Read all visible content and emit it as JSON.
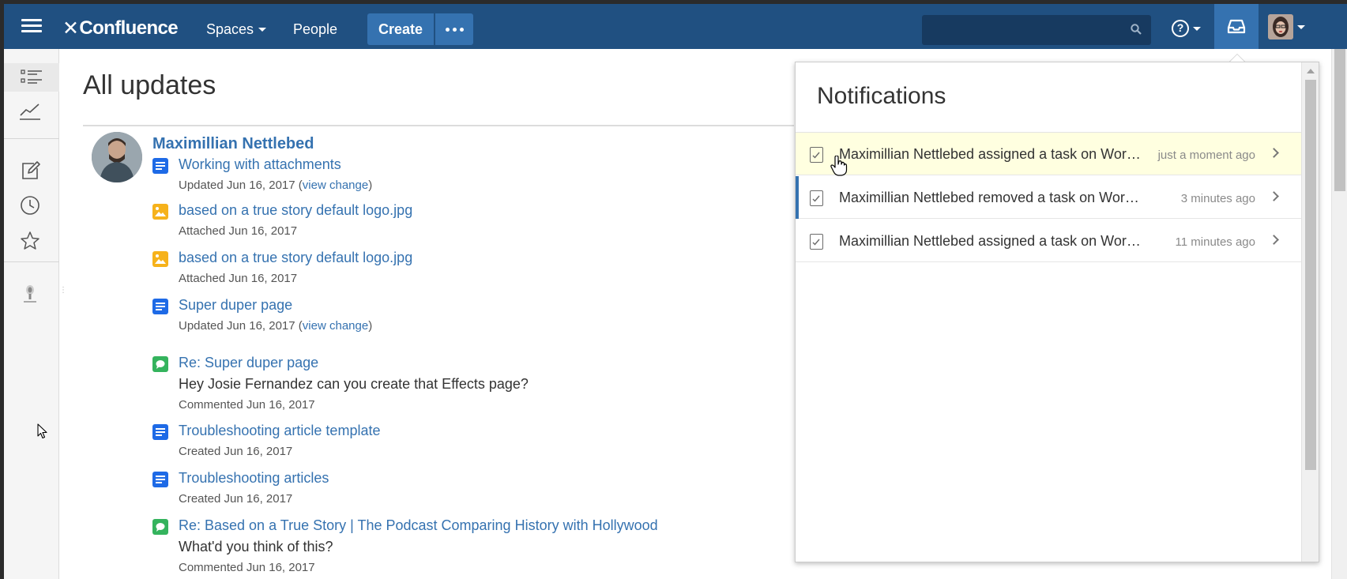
{
  "header": {
    "app_name": "Confluence",
    "logo_mark": "✕",
    "nav": {
      "spaces_label": "Spaces",
      "people_label": "People"
    },
    "create_label": "Create",
    "more_icon": "ellipsis-icon",
    "search": {
      "placeholder": "",
      "value": "",
      "icon": "search-icon"
    },
    "help_icon": "help-icon",
    "help_glyph": "?",
    "notifications_icon": "inbox-icon",
    "avatar_icon": "user-avatar"
  },
  "sidebar": {
    "items": [
      {
        "name": "all-updates",
        "icon": "list-icon",
        "active": true
      },
      {
        "name": "popular",
        "icon": "trending-icon",
        "active": false
      },
      {
        "name": "drafts",
        "icon": "edit-icon",
        "active": false
      },
      {
        "name": "recently-worked",
        "icon": "clock-icon",
        "active": false
      },
      {
        "name": "saved",
        "icon": "star-icon",
        "active": false
      },
      {
        "name": "space",
        "icon": "space-logo-icon",
        "active": false
      }
    ]
  },
  "main": {
    "title": "All updates",
    "author": "Maximillian Nettlebed",
    "items": [
      {
        "type": "page",
        "title": "Working with attachments",
        "meta": "Updated Jun 16, 2017 (",
        "link": "view change",
        "meta_end": ")"
      },
      {
        "type": "image",
        "title": "based on a true story default logo.jpg",
        "meta": "Attached Jun 16, 2017"
      },
      {
        "type": "image",
        "title": "based on a true story default logo.jpg",
        "meta": "Attached Jun 16, 2017"
      },
      {
        "type": "page",
        "title": "Super duper page",
        "meta": "Updated Jun 16, 2017 (",
        "link": "view change",
        "meta_end": ")"
      },
      {
        "type": "comment",
        "title": "Re: Super duper page",
        "body": "Hey Josie Fernandez can you create that Effects page?",
        "meta": "Commented Jun 16, 2017"
      },
      {
        "type": "page",
        "title": "Troubleshooting article template",
        "meta": "Created Jun 16, 2017"
      },
      {
        "type": "page",
        "title": "Troubleshooting articles",
        "meta": "Created Jun 16, 2017"
      },
      {
        "type": "comment",
        "title": "Re: Based on a True Story | The Podcast Comparing History with Hollywood",
        "body": "What'd you think of this?",
        "meta": "Commented Jun 16, 2017"
      }
    ]
  },
  "notifications": {
    "title": "Notifications",
    "items": [
      {
        "text": "Maximillian Nettlebed assigned a task on Working with attachments",
        "time": "just a moment ago",
        "state": "hover",
        "icon": "task-icon"
      },
      {
        "text": "Maximillian Nettlebed removed a task on Working with attachments",
        "time": "3 minutes ago",
        "state": "unread",
        "icon": "task-icon"
      },
      {
        "text": "Maximillian Nettlebed assigned a task on Working with attachments",
        "time": "11 minutes ago",
        "state": "read",
        "icon": "task-icon"
      }
    ]
  },
  "colors": {
    "header_bg": "#205081",
    "accent": "#3572b0",
    "link": "#3572b0",
    "hover_row": "#ffffe0",
    "page_icon": "#1e6ae6",
    "image_icon": "#f6b21b",
    "comment_icon": "#34b35d"
  }
}
